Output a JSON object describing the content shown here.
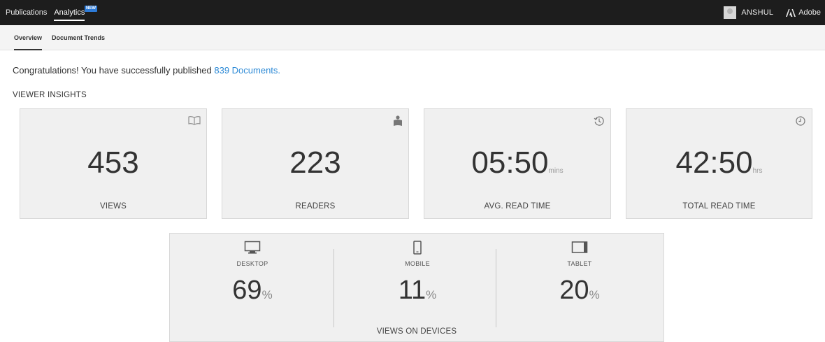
{
  "topbar": {
    "nav": [
      "Publications",
      "Analytics"
    ],
    "new_badge": "NEW",
    "user": "ANSHUL",
    "brand": "Adobe"
  },
  "subtabs": [
    "Overview",
    "Document Trends"
  ],
  "congrats": {
    "text": "Congratulations! You have successfully published ",
    "link": "839 Documents."
  },
  "section_title": "VIEWER INSIGHTS",
  "cards": [
    {
      "icon": "book-icon",
      "value": "453",
      "unit": "",
      "label": "VIEWS"
    },
    {
      "icon": "reader-icon",
      "value": "223",
      "unit": "",
      "label": "READERS"
    },
    {
      "icon": "history-icon",
      "value": "05:50",
      "unit": "mins",
      "label": "AVG. READ TIME"
    },
    {
      "icon": "clock-icon",
      "value": "42:50",
      "unit": "hrs",
      "label": "TOTAL READ TIME"
    }
  ],
  "devices": {
    "items": [
      {
        "icon": "desktop-icon",
        "label": "DESKTOP",
        "value": "69",
        "unit": "%"
      },
      {
        "icon": "mobile-icon",
        "label": "MOBILE",
        "value": "11",
        "unit": "%"
      },
      {
        "icon": "tablet-icon",
        "label": "TABLET",
        "value": "20",
        "unit": "%"
      }
    ],
    "footer": "VIEWS ON DEVICES"
  }
}
